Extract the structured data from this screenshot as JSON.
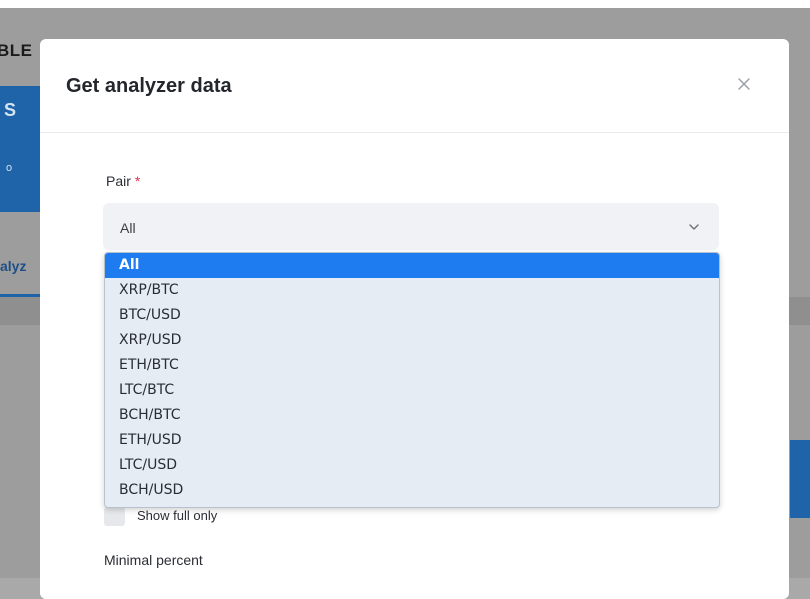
{
  "background": {
    "title_fragment": "BLE",
    "card_fragment_top": "S",
    "card_fragment_bottom": "o",
    "tab_fragment": "alyz"
  },
  "modal": {
    "title": "Get analyzer data",
    "close_icon": "close-icon",
    "pair_field": {
      "label": "Pair",
      "required_mark": "*",
      "selected_value": "All",
      "chevron_icon": "chevron-down-icon"
    },
    "dropdown_options": [
      "All",
      "XRP/BTC",
      "BTC/USD",
      "XRP/USD",
      "ETH/BTC",
      "LTC/BTC",
      "BCH/BTC",
      "ETH/USD",
      "LTC/USD",
      "BCH/USD"
    ],
    "selected_option_index": 0,
    "show_full_only": {
      "label": "Show full only",
      "checked": false
    },
    "minimal_percent_label": "Minimal percent"
  },
  "colors": {
    "accent_blue": "#1e7cf0",
    "required_red": "#e0314b",
    "backdrop_blue": "#1f63a8"
  }
}
